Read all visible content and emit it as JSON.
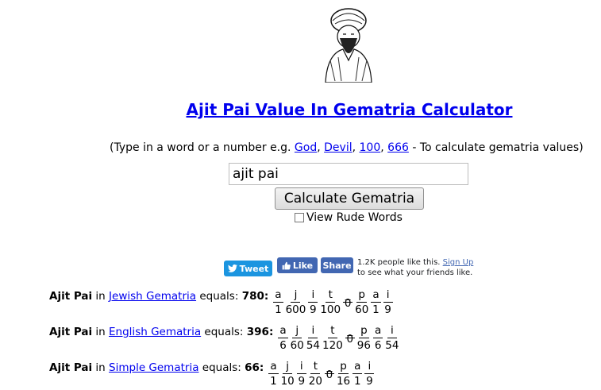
{
  "title": "Ajit Pai Value In Gematria Calculator",
  "hint": {
    "prefix": "(Type in a word or a number e.g. ",
    "links": [
      "God",
      "Devil",
      "100",
      "666"
    ],
    "sep": ", ",
    "suffix": " - To calculate gematria values)"
  },
  "search": {
    "value": "ajit pai"
  },
  "calculate_label": "Calculate Gematria",
  "rude_label": "View Rude Words",
  "social": {
    "tweet": "Tweet",
    "like": "Like",
    "share": "Share",
    "like_count_text": "1.2K people like this.",
    "signup_link": "Sign Up",
    "signup_rest": "to see what your friends like."
  },
  "results": [
    {
      "word": "Ajit Pai",
      "in": " in ",
      "method": "Jewish Gematria",
      "equals": " equals: ",
      "value": "780",
      "letters": [
        [
          "a",
          "1"
        ],
        [
          "j",
          "600"
        ],
        [
          "i",
          "9"
        ],
        [
          "t",
          "100"
        ],
        [
          "_",
          "0"
        ],
        [
          "p",
          "60"
        ],
        [
          "a",
          "1"
        ],
        [
          "i",
          "9"
        ]
      ]
    },
    {
      "word": "Ajit Pai",
      "in": " in ",
      "method": "English Gematria",
      "equals": " equals: ",
      "value": "396",
      "letters": [
        [
          "a",
          "6"
        ],
        [
          "j",
          "60"
        ],
        [
          "i",
          "54"
        ],
        [
          "t",
          "120"
        ],
        [
          "_",
          "0"
        ],
        [
          "p",
          "96"
        ],
        [
          "a",
          "6"
        ],
        [
          "i",
          "54"
        ]
      ]
    },
    {
      "word": "Ajit Pai",
      "in": " in ",
      "method": "Simple Gematria",
      "equals": " equals: ",
      "value": "66",
      "letters": [
        [
          "a",
          "1"
        ],
        [
          "j",
          "10"
        ],
        [
          "i",
          "9"
        ],
        [
          "t",
          "20"
        ],
        [
          "_",
          "0"
        ],
        [
          "p",
          "16"
        ],
        [
          "a",
          "1"
        ],
        [
          "i",
          "9"
        ]
      ]
    }
  ],
  "icons": {
    "portrait": "portrait-image",
    "twitter": "twitter-bird-icon",
    "like": "thumbs-up-icon"
  },
  "colors": {
    "link": "#0000ee",
    "tweet": "#1b95e0",
    "facebook": "#4267b2"
  }
}
